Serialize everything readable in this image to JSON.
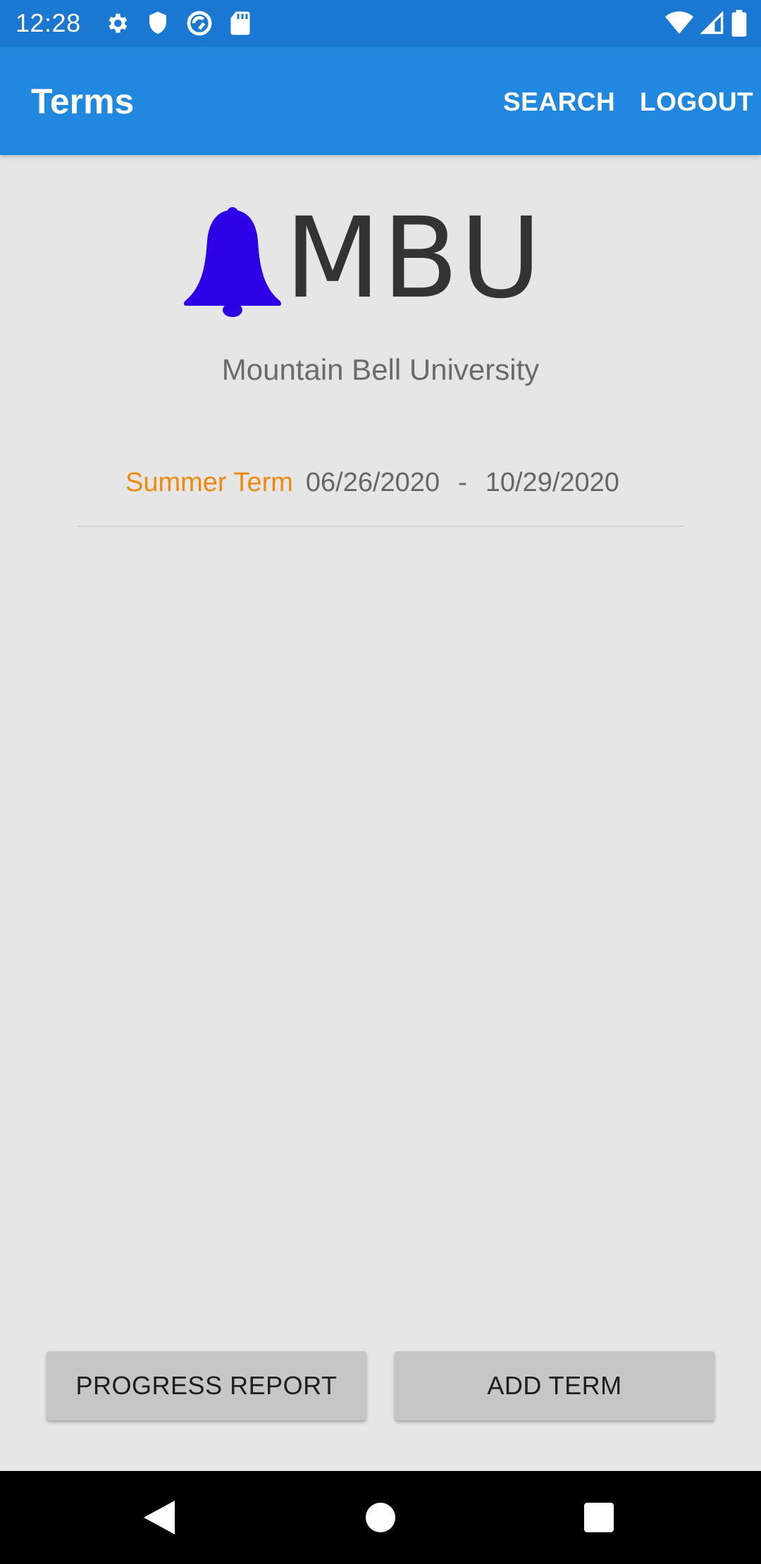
{
  "status_bar": {
    "time": "12:28",
    "left_icons": [
      "gear-icon",
      "shield-icon",
      "sync-icon",
      "sd-card-icon"
    ],
    "right_icons": [
      "wifi-icon",
      "signal-icon",
      "battery-icon"
    ]
  },
  "app_bar": {
    "title": "Terms",
    "search_label": "SEARCH",
    "logout_label": "LOGOUT"
  },
  "logo": {
    "icon": "bell-icon",
    "text": "MBU"
  },
  "university_name": "Mountain Bell University",
  "terms": [
    {
      "name": "Summer Term",
      "start_date": "06/26/2020",
      "separator": "-",
      "end_date": "10/29/2020"
    }
  ],
  "buttons": {
    "progress_report": "PROGRESS REPORT",
    "add_term": "ADD TERM"
  },
  "nav_bar": {
    "icons": [
      "back-icon",
      "home-icon",
      "recents-icon"
    ]
  },
  "colors": {
    "status_bar": "#1a78d2",
    "app_bar": "#2089df",
    "background": "#e6e6e6",
    "term_name": "#ef8a0e",
    "bell": "#2e00e6",
    "button": "#c6c6c6"
  }
}
